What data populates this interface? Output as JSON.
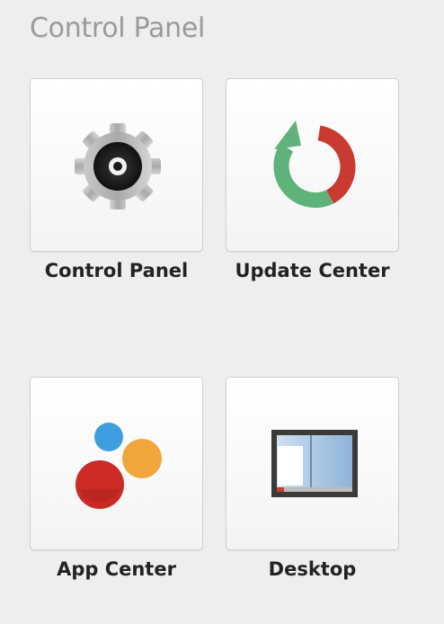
{
  "section": {
    "title": "Control Panel"
  },
  "tiles": [
    {
      "label": "Control Panel",
      "icon": "gear-icon"
    },
    {
      "label": "Update Center",
      "icon": "refresh-arrow-icon"
    },
    {
      "label": "App Center",
      "icon": "app-center-bubbles-icon"
    },
    {
      "label": "Desktop",
      "icon": "desktop-window-icon"
    }
  ],
  "colors": {
    "background": "#eeeeee",
    "heading": "#9a9a9a",
    "label": "#222222",
    "tile_border": "#cfcfcf",
    "update_green": "#5fb27a",
    "update_red": "#c93a31",
    "app_blue": "#3e9ee0",
    "app_orange": "#f0a63a",
    "app_red": "#cc2a24"
  }
}
